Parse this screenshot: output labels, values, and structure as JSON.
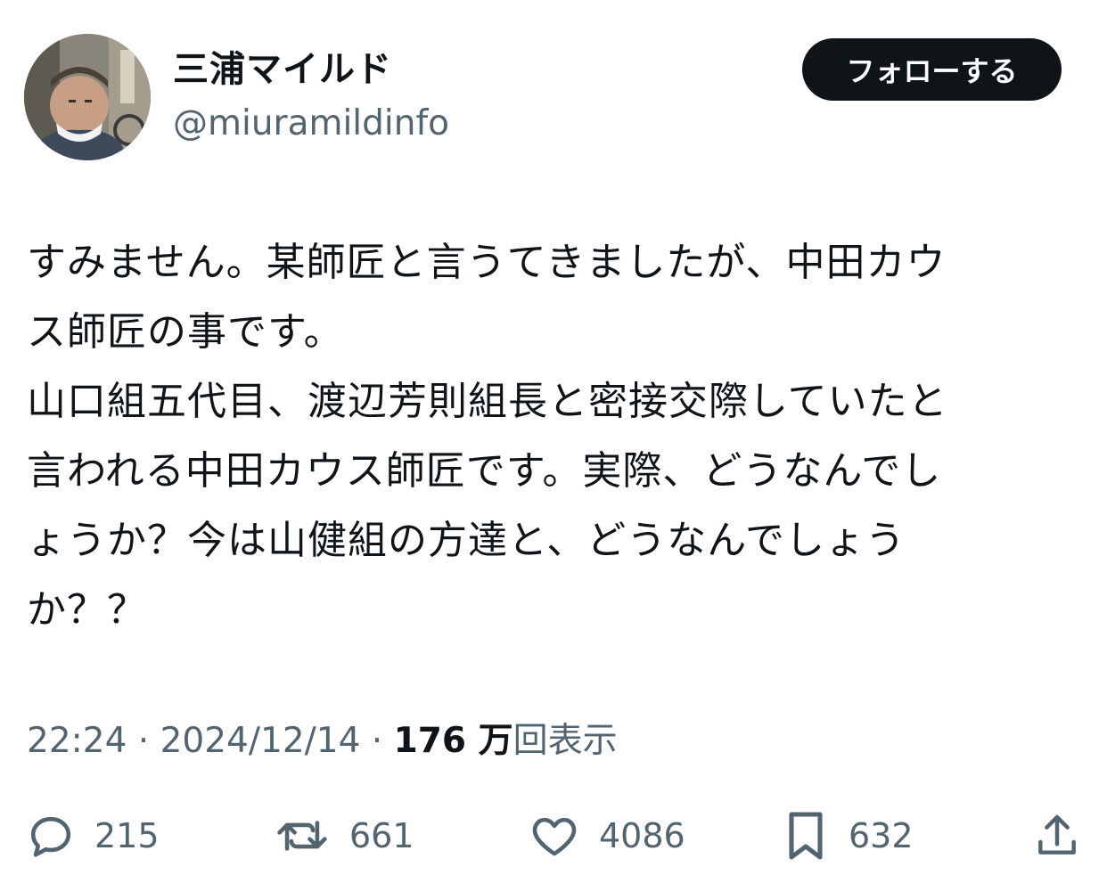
{
  "author": {
    "display_name": "三浦マイルド",
    "handle": "@miuramildinfo",
    "avatar_icon": "profile-photo"
  },
  "follow_button": {
    "label": "フォローする"
  },
  "tweet": {
    "lines": [
      "すみません。某師匠と言うてきましたが、中田カウ",
      "ス師匠の事です。",
      "山口組五代目、渡辺芳則組長と密接交際していたと",
      "言われる中田カウス師匠です。実際、どうなんでし",
      "ょうか？今は山健組の方達と、どうなんでしょう",
      "か？？"
    ]
  },
  "meta": {
    "time": "22:24",
    "separator1": " · ",
    "date": "2024/12/14",
    "separator2": " · ",
    "views_count": "176 万",
    "views_label": "回表示"
  },
  "actions": {
    "reply": {
      "icon": "reply-icon",
      "count": "215"
    },
    "retweet": {
      "icon": "retweet-icon",
      "count": "661"
    },
    "like": {
      "icon": "heart-icon",
      "count": "4086"
    },
    "bookmark": {
      "icon": "bookmark-icon",
      "count": "632"
    },
    "share": {
      "icon": "share-icon"
    }
  },
  "colors": {
    "text_primary": "#0f1419",
    "text_secondary": "#536471",
    "button_bg": "#0f1419",
    "button_text": "#ffffff",
    "background": "#ffffff"
  }
}
